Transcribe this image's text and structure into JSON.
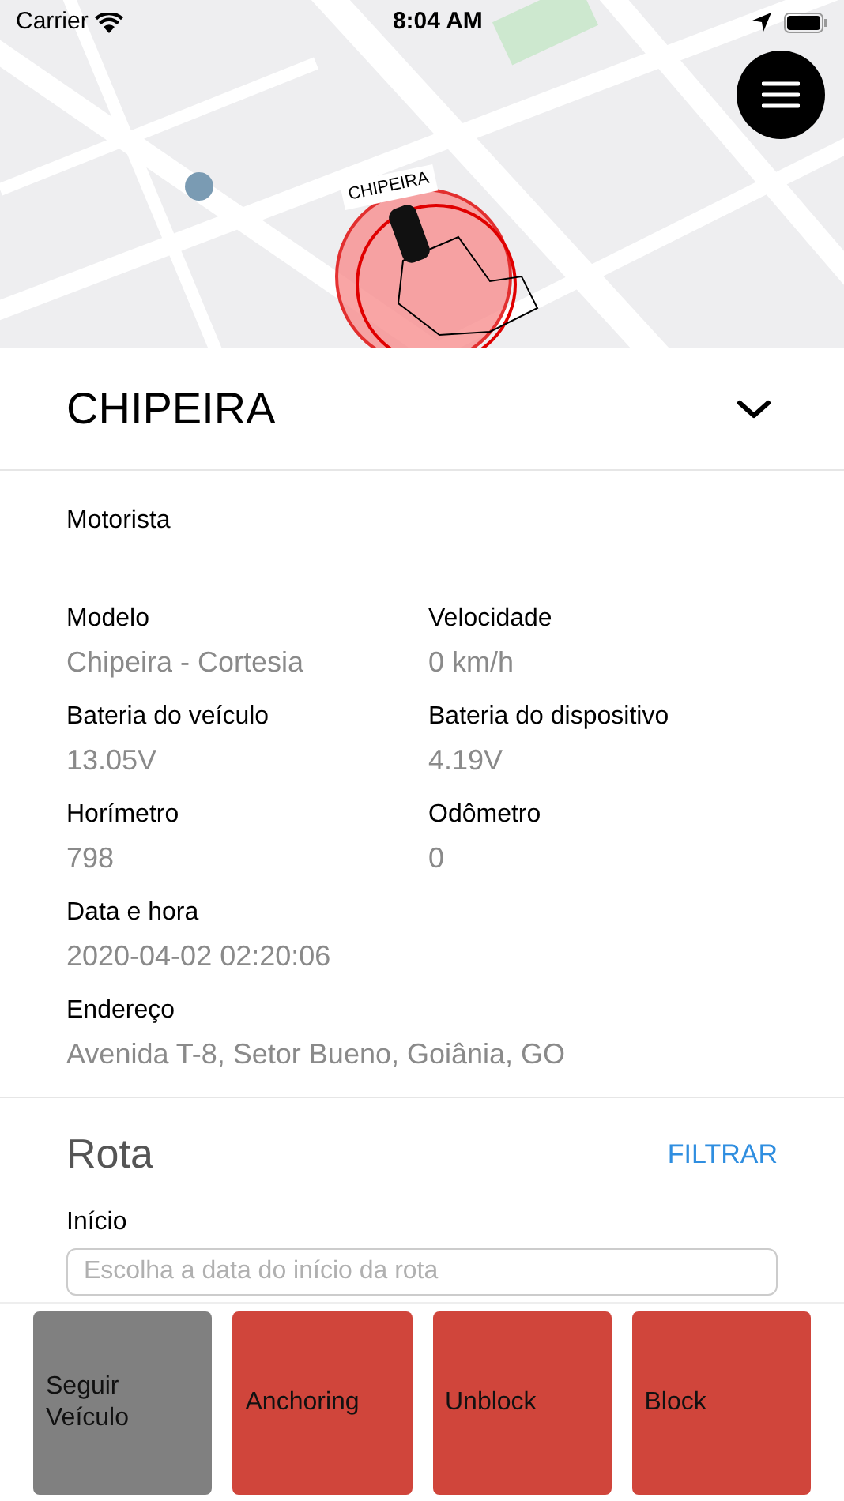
{
  "status_bar": {
    "carrier": "Carrier",
    "time": "8:04 AM"
  },
  "map": {
    "marker_label": "CHIPEIRA"
  },
  "vehicle": {
    "title": "CHIPEIRA",
    "expanded": true
  },
  "driver_label": "Motorista",
  "fields": [
    {
      "label": "Modelo",
      "value": "Chipeira - Cortesia"
    },
    {
      "label": "Velocidade",
      "value": "0 km/h"
    },
    {
      "label": "Bateria do veículo",
      "value": "13.05V"
    },
    {
      "label": "Bateria do dispositivo",
      "value": "4.19V"
    },
    {
      "label": "Horímetro",
      "value": "798"
    },
    {
      "label": "Odômetro",
      "value": "0"
    },
    {
      "label": "Data e hora",
      "value": "2020-04-02 02:20:06",
      "wide": true
    },
    {
      "label": "Endereço",
      "value": "Avenida T-8, Setor Bueno, Goiânia, GO",
      "wide": true
    }
  ],
  "route": {
    "title": "Rota",
    "filter": "FILTRAR",
    "start_label": "Início",
    "start_placeholder": "Escolha a data do início da rota"
  },
  "actions": [
    {
      "label": "Seguir Veículo",
      "color": "#808080"
    },
    {
      "label": "Anchoring",
      "color": "#d0453b"
    },
    {
      "label": "Unblock",
      "color": "#d0453b"
    },
    {
      "label": "Block",
      "color": "#d0453b"
    }
  ]
}
